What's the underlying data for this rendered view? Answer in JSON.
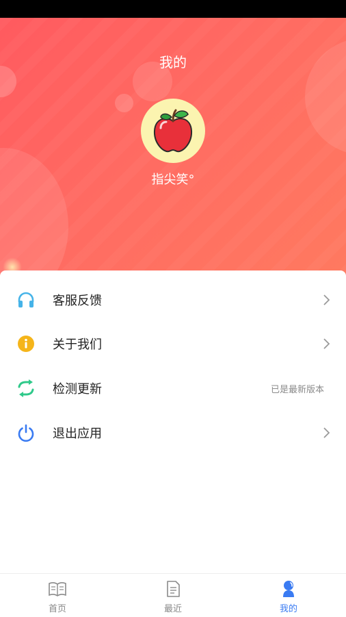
{
  "header": {
    "title": "我的",
    "username": "指尖笑°",
    "avatar": "apple-avatar"
  },
  "menu": {
    "items": [
      {
        "label": "客服反馈",
        "icon": "headphones-icon",
        "action": "chevron"
      },
      {
        "label": "关于我们",
        "icon": "info-icon",
        "action": "chevron"
      },
      {
        "label": "检测更新",
        "icon": "refresh-icon",
        "note": "已是最新版本"
      },
      {
        "label": "退出应用",
        "icon": "power-icon",
        "action": "chevron"
      }
    ]
  },
  "tabbar": {
    "tabs": [
      {
        "label": "首页",
        "icon": "book-icon"
      },
      {
        "label": "最近",
        "icon": "document-icon"
      },
      {
        "label": "我的",
        "icon": "user-icon",
        "active": true
      }
    ]
  },
  "colors": {
    "hero_start": "#ff5a5f",
    "hero_end": "#ff7a60",
    "active_tab": "#3a7bf2",
    "headphones": "#45b3e8",
    "info": "#f5b51a",
    "refresh": "#2fc98a",
    "power": "#3a7bf2"
  }
}
